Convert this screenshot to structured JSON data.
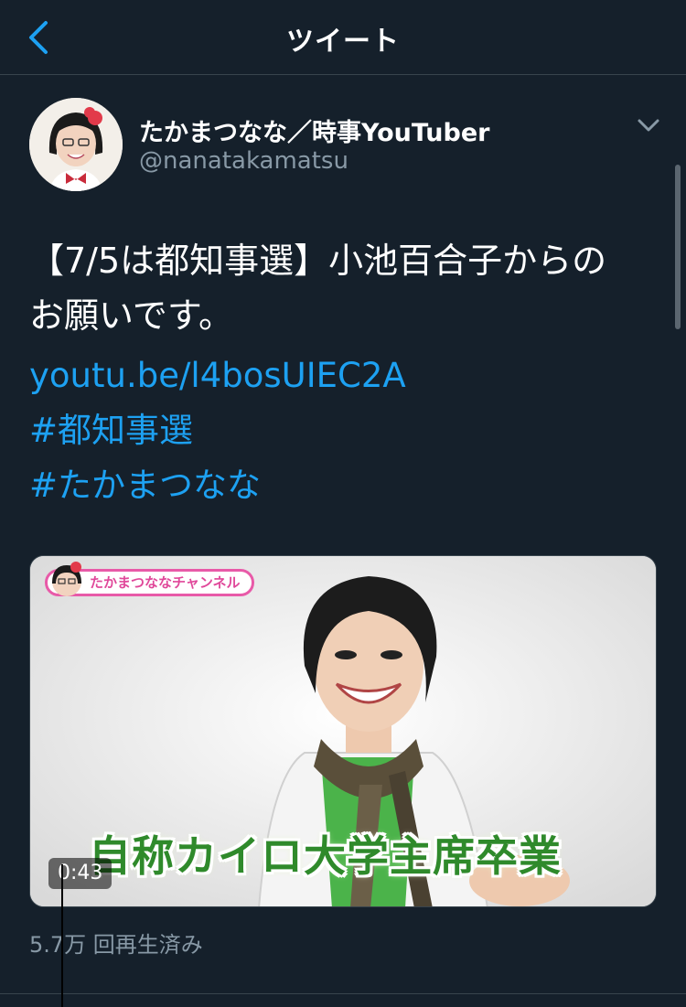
{
  "header": {
    "title": "ツイート",
    "back_icon": "chevron-left-icon",
    "accent": "#1da1f2"
  },
  "tweet": {
    "display_name": "たかまつなな／時事YouTuber",
    "handle": "@nanatakamatsu",
    "menu_icon": "chevron-down-icon",
    "text": "【7/5は都知事選】小池百合子からの\nお願いです。",
    "link": "youtu.be/l4bosUIEC2A",
    "hashtags": [
      "#都知事選",
      "#たかまつなな"
    ]
  },
  "media": {
    "channel_label": "たかまつななチャンネル",
    "caption": "自称カイロ大学主席卒業",
    "duration": "0:43",
    "views": "5.7万 回再生済み"
  },
  "colors": {
    "background": "#15202b",
    "divider": "#38444d",
    "muted": "#8899a6",
    "link": "#1da1f2",
    "caption_green": "#2f8a2b",
    "badge_pink": "#e85aa8"
  }
}
